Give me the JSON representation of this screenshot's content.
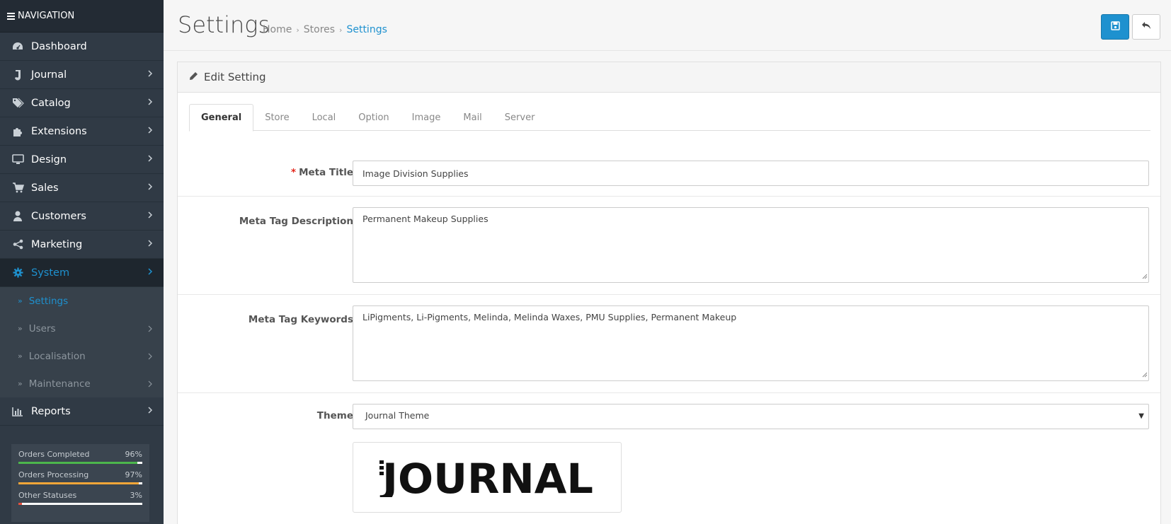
{
  "nav": {
    "header": "NAVIGATION",
    "items": [
      {
        "label": "Dashboard",
        "icon": "dashboard-icon",
        "has_arrow": false
      },
      {
        "label": "Journal",
        "icon": "journal-icon",
        "has_arrow": true
      },
      {
        "label": "Catalog",
        "icon": "tags-icon",
        "has_arrow": true
      },
      {
        "label": "Extensions",
        "icon": "puzzle-icon",
        "has_arrow": true
      },
      {
        "label": "Design",
        "icon": "monitor-icon",
        "has_arrow": true
      },
      {
        "label": "Sales",
        "icon": "cart-icon",
        "has_arrow": true
      },
      {
        "label": "Customers",
        "icon": "user-icon",
        "has_arrow": true
      },
      {
        "label": "Marketing",
        "icon": "share-icon",
        "has_arrow": true
      },
      {
        "label": "System",
        "icon": "gear-icon",
        "has_arrow": true,
        "active": true
      }
    ],
    "submenu": [
      {
        "label": "Settings",
        "active": true
      },
      {
        "label": "Users"
      },
      {
        "label": "Localisation"
      },
      {
        "label": "Maintenance"
      }
    ],
    "reports": {
      "label": "Reports",
      "icon": "bar-chart-icon"
    }
  },
  "stats": [
    {
      "label": "Orders Completed",
      "value": "96%",
      "fraction": 0.96,
      "color": "#4cb64c"
    },
    {
      "label": "Orders Processing",
      "value": "97%",
      "fraction": 0.97,
      "color": "#f3a638"
    },
    {
      "label": "Other Statuses",
      "value": "3%",
      "fraction": 0.03,
      "color": "#e3503e"
    }
  ],
  "header": {
    "title": "Settings",
    "breadcrumb": [
      "Home",
      "Stores",
      "Settings"
    ]
  },
  "panel": {
    "heading": "Edit Setting",
    "tabs": [
      "General",
      "Store",
      "Local",
      "Option",
      "Image",
      "Mail",
      "Server"
    ],
    "active_tab": "General"
  },
  "form": {
    "meta_title_label": "Meta Title",
    "meta_title_value": "Image Division Supplies",
    "meta_description_label": "Meta Tag Description",
    "meta_description_value": "Permanent Makeup Supplies",
    "meta_keywords_label": "Meta Tag Keywords",
    "meta_keywords_value": "LiPigments, Li-Pigments, Melinda, Melinda Waxes, PMU Supplies, Permanent Makeup",
    "theme_label": "Theme",
    "theme_value": "Journal Theme",
    "theme_logo_text": "JOURNAL"
  },
  "colors": {
    "accent": "#1e91cf",
    "sidebar": "#303a45",
    "required": "#e3261b"
  }
}
